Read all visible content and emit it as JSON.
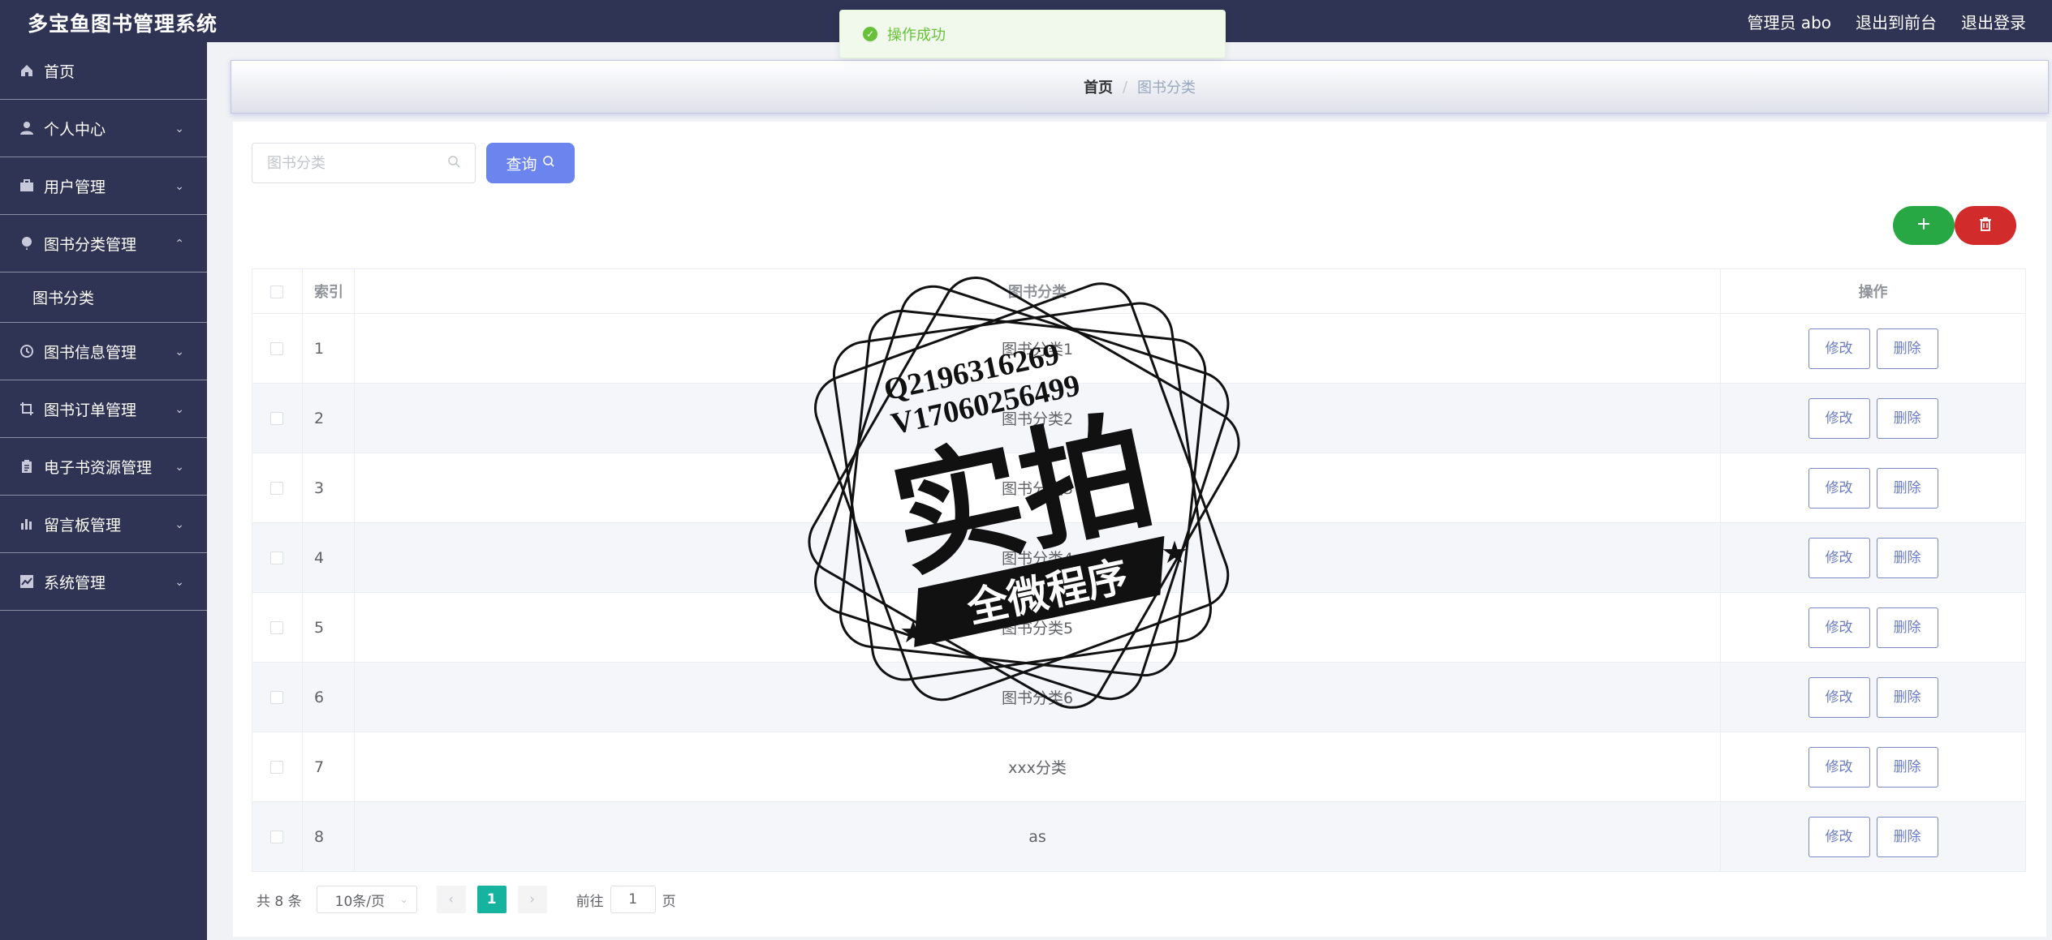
{
  "header": {
    "brand": "多宝鱼图书管理系统",
    "admin": "管理员 abo",
    "front_link": "退出到前台",
    "logout_link": "退出登录"
  },
  "toast": {
    "message": "操作成功"
  },
  "sidebar": {
    "items": [
      {
        "label": "首页",
        "icon": "home-icon"
      },
      {
        "label": "个人中心",
        "icon": "user-icon"
      },
      {
        "label": "用户管理",
        "icon": "briefcase-icon"
      },
      {
        "label": "图书分类管理",
        "icon": "balloon-icon"
      },
      {
        "label": "图书信息管理",
        "icon": "clock-icon"
      },
      {
        "label": "图书订单管理",
        "icon": "crop-icon"
      },
      {
        "label": "电子书资源管理",
        "icon": "clipboard-icon"
      },
      {
        "label": "留言板管理",
        "icon": "chart-icon"
      },
      {
        "label": "系统管理",
        "icon": "trend-icon"
      }
    ],
    "sub_item": "图书分类"
  },
  "breadcrumb": {
    "home": "首页",
    "separator": "/",
    "current": "图书分类"
  },
  "search": {
    "placeholder": "图书分类",
    "value": "",
    "button": "查询"
  },
  "table": {
    "headers": {
      "index": "索引",
      "name": "图书分类",
      "ops": "操作"
    },
    "edit_label": "修改",
    "delete_label": "删除",
    "rows": [
      {
        "index": "1",
        "name": "图书分类1"
      },
      {
        "index": "2",
        "name": "图书分类2"
      },
      {
        "index": "3",
        "name": "图书分类3"
      },
      {
        "index": "4",
        "name": "图书分类4"
      },
      {
        "index": "5",
        "name": "图书分类5"
      },
      {
        "index": "6",
        "name": "图书分类6"
      },
      {
        "index": "7",
        "name": "xxx分类"
      },
      {
        "index": "8",
        "name": "as"
      }
    ]
  },
  "pagination": {
    "total": "共 8 条",
    "page_size": "10条/页",
    "current_page": "1",
    "goto_prefix": "前往",
    "goto_value": "1",
    "goto_suffix": "页"
  },
  "watermark": {
    "line1": "Q2196316269",
    "line2": "V17060256499",
    "big_text": "实拍",
    "banner_text": "全微程序"
  },
  "colors": {
    "sidebar_bg": "#2f3354",
    "query_button": "#6b84ee",
    "add_button": "#28a745",
    "delete_button": "#d22b2b",
    "current_page": "#16b49e",
    "toast_success": "#67c23a"
  }
}
